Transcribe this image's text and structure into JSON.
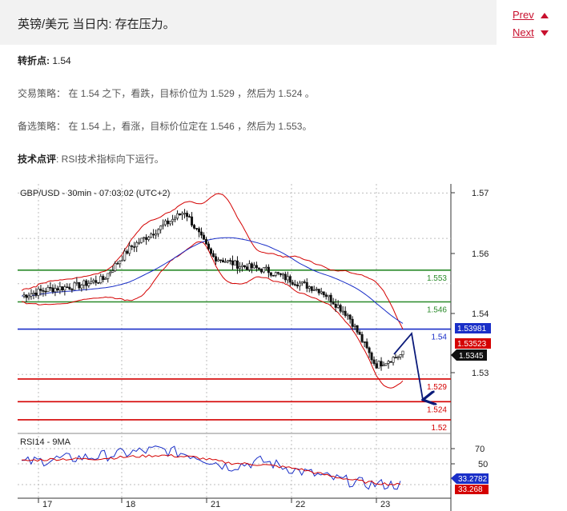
{
  "header": {
    "title": "英镑/美元 当日内: 存在压力。",
    "prev_label": "Prev",
    "next_label": "Next"
  },
  "analysis": {
    "pivot_label": "转折点:",
    "pivot_value": "1.54",
    "strategy_label": "交易策略：",
    "strategy_text": "在 1.54 之下，看跌，目标价位为 1.529 ，然后为 1.524 。",
    "alt_label": "备选策略：",
    "alt_text": "在 1.54 上，看涨，目标价位定在 1.546 ，然后为 1.553。",
    "comment_label": "技术点评",
    "comment_text": ": RSI技术指标向下运行。"
  },
  "chart": {
    "caption": "GBP/USD - 30min - 07:03:02 (UTC+2)",
    "rsi_caption": "RSI14 - 9MA",
    "price_ticks": [
      "1.57",
      "1.56",
      "1.54",
      "1.53"
    ],
    "rsi_ticks": [
      "70",
      "50"
    ],
    "date_ticks": [
      "17",
      "18",
      "21",
      "22",
      "23"
    ],
    "levels": [
      {
        "label": "1.553",
        "value": 1.553,
        "color": "#2a8a2a"
      },
      {
        "label": "1.546",
        "value": 1.546,
        "color": "#2a8a2a"
      },
      {
        "label": "1.54",
        "value": 1.54,
        "color": "#1a2fc8"
      },
      {
        "label": "1.529",
        "value": 1.529,
        "color": "#d40000"
      },
      {
        "label": "1.524",
        "value": 1.524,
        "color": "#d40000"
      },
      {
        "label": "1.52",
        "value": 1.52,
        "color": "#d40000"
      }
    ],
    "tags": {
      "ma": "1.53981",
      "upper": "1.53523",
      "last": "1.5345",
      "rsi": "33.2782",
      "rsi_ma": "33.268"
    },
    "colors": {
      "candles": "#111111",
      "bollinger": "#d40000",
      "moving_average": "#1a2fc8",
      "arrow": "#0a1a7a"
    }
  },
  "chart_data": {
    "type": "line",
    "title": "GBP/USD - 30min - 07:03:02 (UTC+2)",
    "x": [
      "17",
      "18",
      "21",
      "22",
      "23"
    ],
    "ylim": [
      1.517,
      1.572
    ],
    "series": [
      {
        "values": [
          1.5473,
          1.5488,
          1.5495,
          1.551,
          1.558,
          1.562,
          1.566,
          1.556,
          1.554,
          1.553,
          1.5505,
          1.5485,
          1.543,
          1.532,
          1.5345
        ]
      }
    ],
    "rsi_series": [
      {
        "name": "RSI14",
        "values": [
          56,
          60,
          62,
          66,
          70,
          64,
          52,
          58,
          48,
          40,
          34,
          33
        ]
      },
      {
        "name": "9MA",
        "values": [
          58,
          60,
          60,
          62,
          64,
          62,
          56,
          54,
          50,
          42,
          36,
          33
        ]
      }
    ],
    "grid": true
  }
}
